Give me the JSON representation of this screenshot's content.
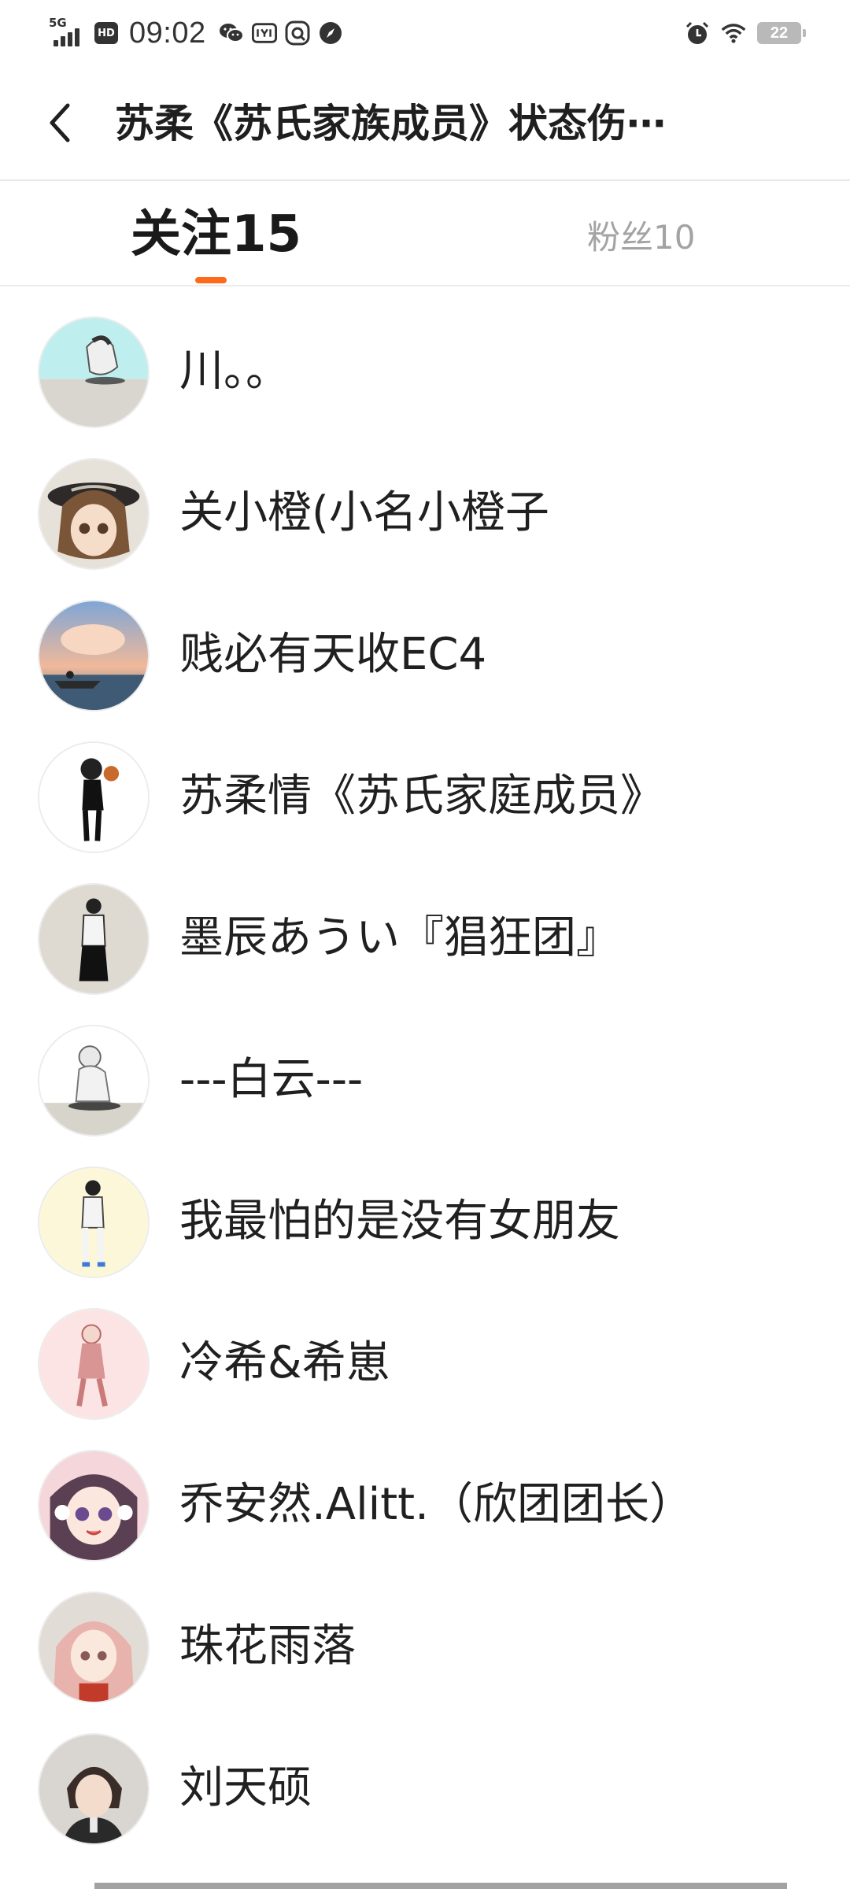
{
  "status_bar": {
    "network": "5G",
    "hd": "HD",
    "time": "09:02",
    "battery": "22"
  },
  "header": {
    "title": "苏柔《苏氏家族成员》状态伤⋯"
  },
  "tabs": {
    "following": "关注15",
    "fans": "粉丝10"
  },
  "list": [
    {
      "name": "川。。"
    },
    {
      "name": "关小橙(小名小橙子"
    },
    {
      "name": "贱必有天收EC4"
    },
    {
      "name": "苏柔情《苏氏家庭成员》"
    },
    {
      "name": "墨辰あうい『猖狂团』"
    },
    {
      "name": "---白云---"
    },
    {
      "name": "我最怕的是没有女朋友"
    },
    {
      "name": "冷希&希崽"
    },
    {
      "name": "乔安然.Alitt.（欣团团长）"
    },
    {
      "name": "珠花雨落"
    },
    {
      "name": "刘天硕"
    }
  ],
  "colors": {
    "accent": "#ff6a1a",
    "text_primary": "#1f1f1f",
    "text_secondary": "#a3a3a3",
    "divider": "#e8e8e8"
  }
}
